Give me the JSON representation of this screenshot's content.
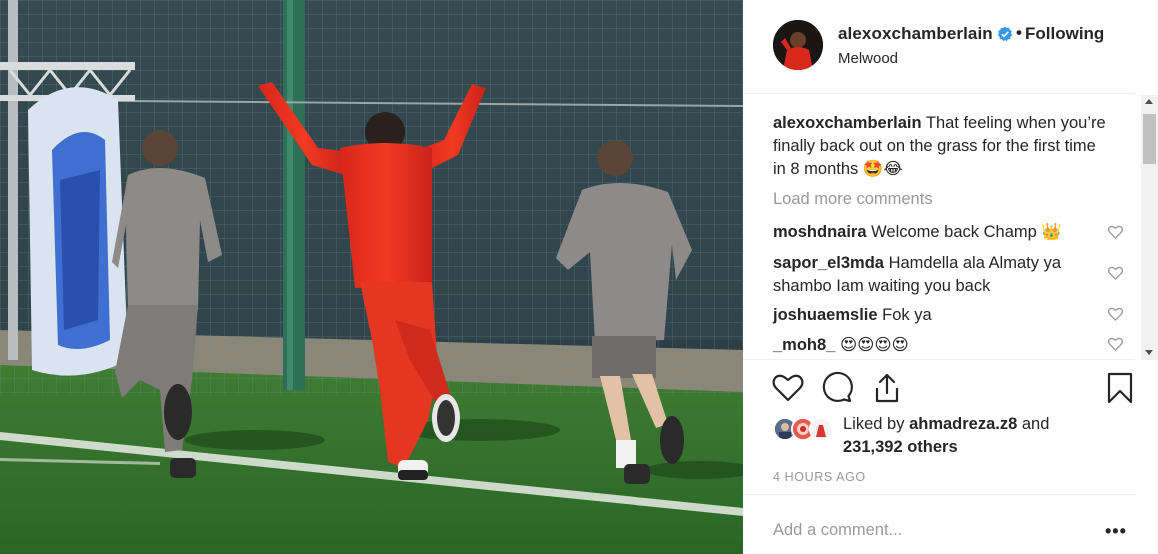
{
  "post": {
    "username": "alexoxchamberlain",
    "separator": "•",
    "follow_status": "Following",
    "location": "Melwood"
  },
  "caption": {
    "username": "alexoxchamberlain",
    "text": "That feeling when you’re finally back out on the grass for the first time in 8 months 🤩😂"
  },
  "load_more_label": "Load more comments",
  "comments": [
    {
      "username": "moshdnaira",
      "text": "Welcome back Champ 👑"
    },
    {
      "username": "sapor_el3mda",
      "text": "Hamdella ala Almaty ya shambo Iam waiting you back"
    },
    {
      "username": "joshuaemslie",
      "text": "Fok ya"
    },
    {
      "username": "_moh8_",
      "text": "😍😍😍😍"
    }
  ],
  "likes": {
    "prefix": "Liked by",
    "user": "ahmadreza.z8",
    "connector": "and",
    "others": "231,392 others"
  },
  "timestamp": "4 HOURS AGO",
  "add_comment_placeholder": "Add a comment...",
  "more_label": "•••",
  "icons": {
    "verified": "verified-badge-icon",
    "like": "heart-icon",
    "comment": "comment-bubble-icon",
    "share": "share-icon",
    "save": "bookmark-icon",
    "comment_like": "small-heart-icon"
  },
  "colors": {
    "text": "#262626",
    "muted": "#999999",
    "verified_blue": "#3897f0",
    "divider": "#efefef",
    "kit_red": "#e8321d",
    "grass": "#2e6f2a"
  }
}
